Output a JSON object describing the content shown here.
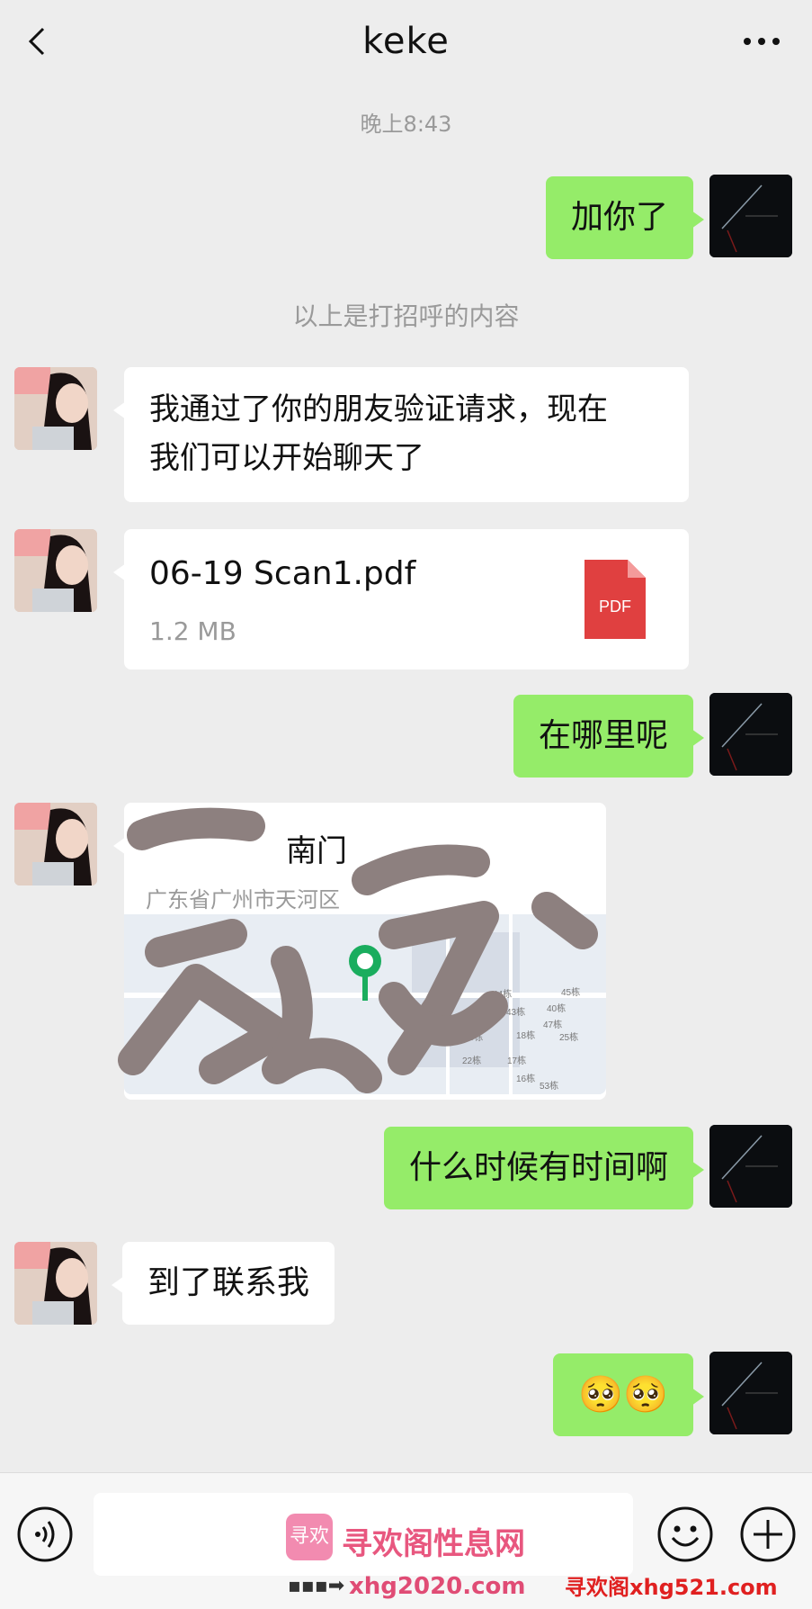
{
  "header": {
    "title": "keke"
  },
  "messages": {
    "timestamp": "晚上8:43",
    "m1": "加你了",
    "system_note": "以上是打招呼的内容",
    "m2": "我通过了你的朋友验证请求，现在\n我们可以开始聊天了",
    "file": {
      "name": "06-19 Scan1.pdf",
      "size": "1.2 MB",
      "type_label": "PDF"
    },
    "m3": "在哪里呢",
    "location": {
      "name": "南门",
      "address": "广东省广州市天河区"
    },
    "m4": "什么时候有时间啊",
    "m5": "到了联系我",
    "m6": "🥺🥺"
  },
  "map_labels": [
    "44栋",
    "45栋",
    "43栋",
    "40栋",
    "47栋",
    "23栋",
    "18栋",
    "25栋",
    "22栋",
    "17栋",
    "16栋",
    "53栋"
  ],
  "input": {
    "placeholder": ""
  },
  "watermark": {
    "logo_text": "寻欢",
    "title": "寻欢阁性息网",
    "url1": "xhg2020.com",
    "url2": "寻欢阁xhg521.com"
  },
  "colors": {
    "background": "#ededed",
    "bubble_sent": "#95ec69",
    "bubble_received": "#ffffff",
    "pdf_red": "#e04040",
    "map_pin": "#1aad5e"
  },
  "icons": {
    "back": "chevron-left-icon",
    "more": "ellipsis-icon",
    "voice": "voice-icon",
    "emoji": "smiley-icon",
    "plus": "plus-icon"
  }
}
